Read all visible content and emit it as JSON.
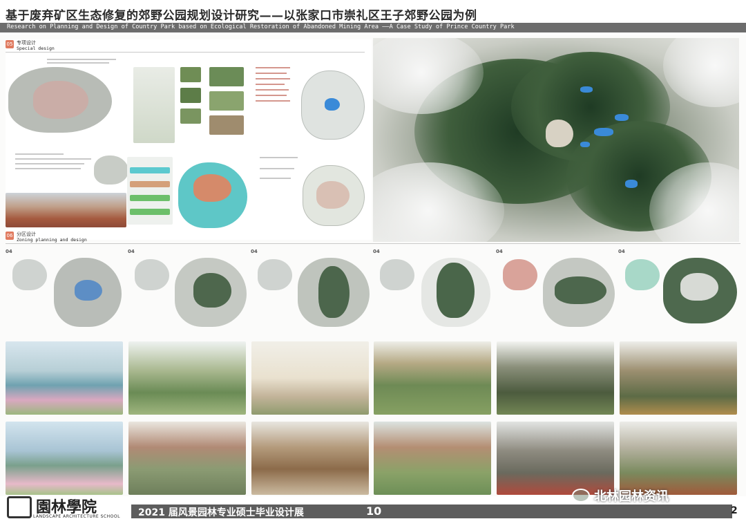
{
  "header": {
    "title_cn": "基于废弃矿区生态修复的郊野公园规划设计研究——以张家口市崇礼区王子郊野公园为例",
    "title_en": "Research on Planning and Design of Country Park based on Ecological Restoration of Abandoned Mining Area ——A Case Study of Prince Country Park"
  },
  "sections": {
    "special": {
      "num": "05",
      "cn": "专项设计",
      "en": "Special design"
    },
    "zoning": {
      "num": "06",
      "cn": "分区设计",
      "en": "Zoning planning and design"
    }
  },
  "zones": [
    {
      "num": "04"
    },
    {
      "num": "04"
    },
    {
      "num": "04"
    },
    {
      "num": "04"
    },
    {
      "num": "04"
    },
    {
      "num": "04"
    }
  ],
  "footer": {
    "logo_cn": "園林學院",
    "logo_en": "LANDSCAPE ARCHITECTURE SCHOOL",
    "exhibition": "2021 届风景园林专业硕士毕业设计展",
    "board_number": "10",
    "page_number": "2",
    "watermark": "北林园林资讯"
  },
  "colors": {
    "header_bar": "#6c6c6c",
    "footer_bar": "#5d5d5d",
    "section_badge": "#e07a5f",
    "water": "#3a8ad8",
    "forest": "#2f4f2f"
  }
}
